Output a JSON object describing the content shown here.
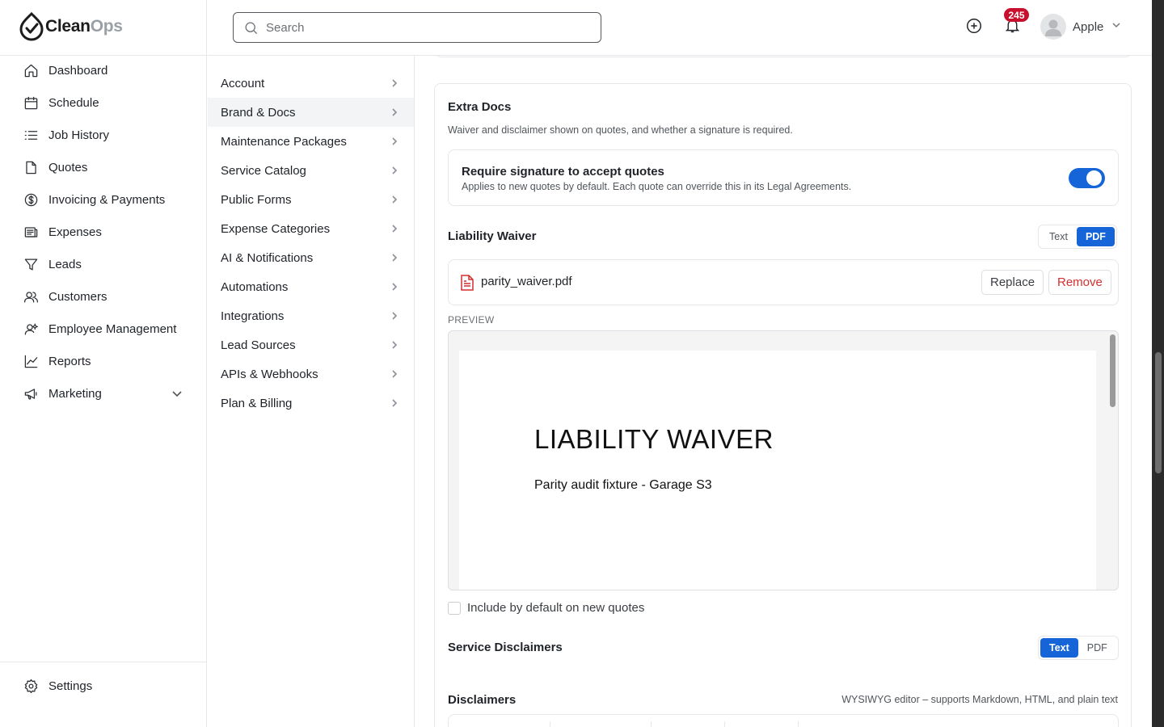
{
  "app": {
    "logo_main": "Clean",
    "logo_accent": "Ops"
  },
  "topbar": {
    "search_placeholder": "Search",
    "notification_count": "245",
    "user_name": "Apple"
  },
  "sidebar": {
    "items": [
      {
        "label": "Dashboard",
        "icon": "home-icon"
      },
      {
        "label": "Schedule",
        "icon": "calendar-icon"
      },
      {
        "label": "Job History",
        "icon": "list-icon"
      },
      {
        "label": "Quotes",
        "icon": "document-icon"
      },
      {
        "label": "Invoicing & Payments",
        "icon": "dollar-circle-icon"
      },
      {
        "label": "Expenses",
        "icon": "receipt-icon"
      },
      {
        "label": "Leads",
        "icon": "funnel-icon"
      },
      {
        "label": "Customers",
        "icon": "users-icon"
      },
      {
        "label": "Employee Management",
        "icon": "user-gear-icon"
      },
      {
        "label": "Reports",
        "icon": "chart-line-icon"
      },
      {
        "label": "Marketing",
        "icon": "megaphone-icon"
      }
    ],
    "settings_label": "Settings"
  },
  "submenu": {
    "active": "Brand & Docs",
    "items": [
      "Account",
      "Brand & Docs",
      "Maintenance Packages",
      "Service Catalog",
      "Public Forms",
      "Expense Categories",
      "AI & Notifications",
      "Automations",
      "Integrations",
      "Lead Sources",
      "APIs & Webhooks",
      "Plan & Billing"
    ]
  },
  "extra_docs": {
    "title": "Extra Docs",
    "description": "Waiver and disclaimer shown on quotes, and whether a signature is required.",
    "signature": {
      "title": "Require signature to accept quotes",
      "subtitle": "Applies to new quotes by default. Each quote can override this in its Legal Agreements.",
      "enabled": true
    },
    "liability_waiver": {
      "label": "Liability Waiver",
      "mode_text": "Text",
      "mode_pdf": "PDF",
      "selected_mode": "PDF",
      "file_name": "parity_waiver.pdf",
      "replace_label": "Replace",
      "remove_label": "Remove",
      "preview_label": "PREVIEW",
      "preview_title": "LIABILITY WAIVER",
      "preview_subtitle": "Parity audit fixture - Garage S3",
      "include_default_label": "Include by default on new quotes",
      "include_default": false
    },
    "service_disclaimers": {
      "label": "Service Disclaimers",
      "mode_text": "Text",
      "mode_pdf": "PDF",
      "selected_mode": "Text"
    },
    "disclaimers": {
      "label": "Disclaimers",
      "hint": "WYSIWYG editor – supports Markdown, HTML, and plain text"
    }
  },
  "colors": {
    "accent": "#1565d8",
    "danger": "#d32f2f",
    "badge": "#c8102e"
  }
}
